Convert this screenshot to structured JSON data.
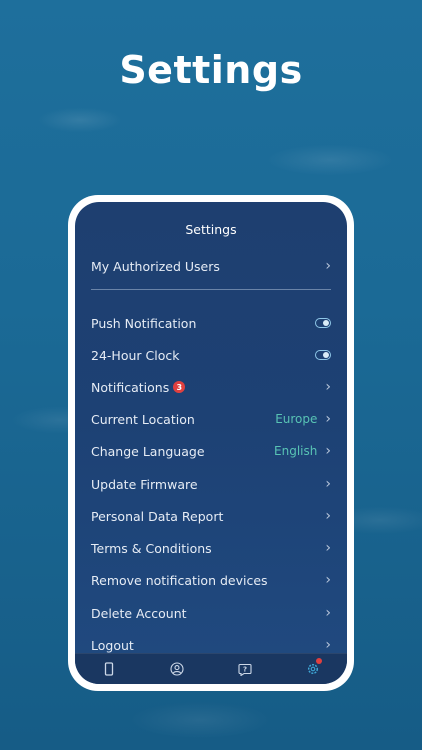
{
  "hero": {
    "title": "Settings"
  },
  "screen": {
    "title": "Settings",
    "authorized_users": "My Authorized Users",
    "items": [
      {
        "label": "Push Notification",
        "control": "toggle",
        "on": true
      },
      {
        "label": "24-Hour Clock",
        "control": "toggle",
        "on": true
      },
      {
        "label": "Notifications",
        "badge": "3",
        "control": "chevron"
      },
      {
        "label": "Current Location",
        "value": "Europe",
        "control": "chevron"
      },
      {
        "label": "Change Language",
        "value": "English",
        "control": "chevron"
      },
      {
        "label": "Update Firmware",
        "control": "chevron"
      },
      {
        "label": "Personal Data Report",
        "control": "chevron"
      },
      {
        "label": "Terms & Conditions",
        "control": "chevron"
      },
      {
        "label": "Remove notification devices",
        "control": "chevron"
      },
      {
        "label": "Delete Account",
        "control": "chevron"
      },
      {
        "label": "Logout",
        "control": "chevron"
      }
    ],
    "chevron_glyph": "›"
  },
  "tabbar": {
    "tabs": [
      {
        "icon": "device-icon"
      },
      {
        "icon": "user-profile-icon"
      },
      {
        "icon": "help-icon"
      },
      {
        "icon": "gear-icon",
        "active": true,
        "has_alert": true
      }
    ]
  },
  "colors": {
    "value_accent": "#58c3b4",
    "badge": "#e0403f",
    "active_tab": "#3fa7d6"
  }
}
